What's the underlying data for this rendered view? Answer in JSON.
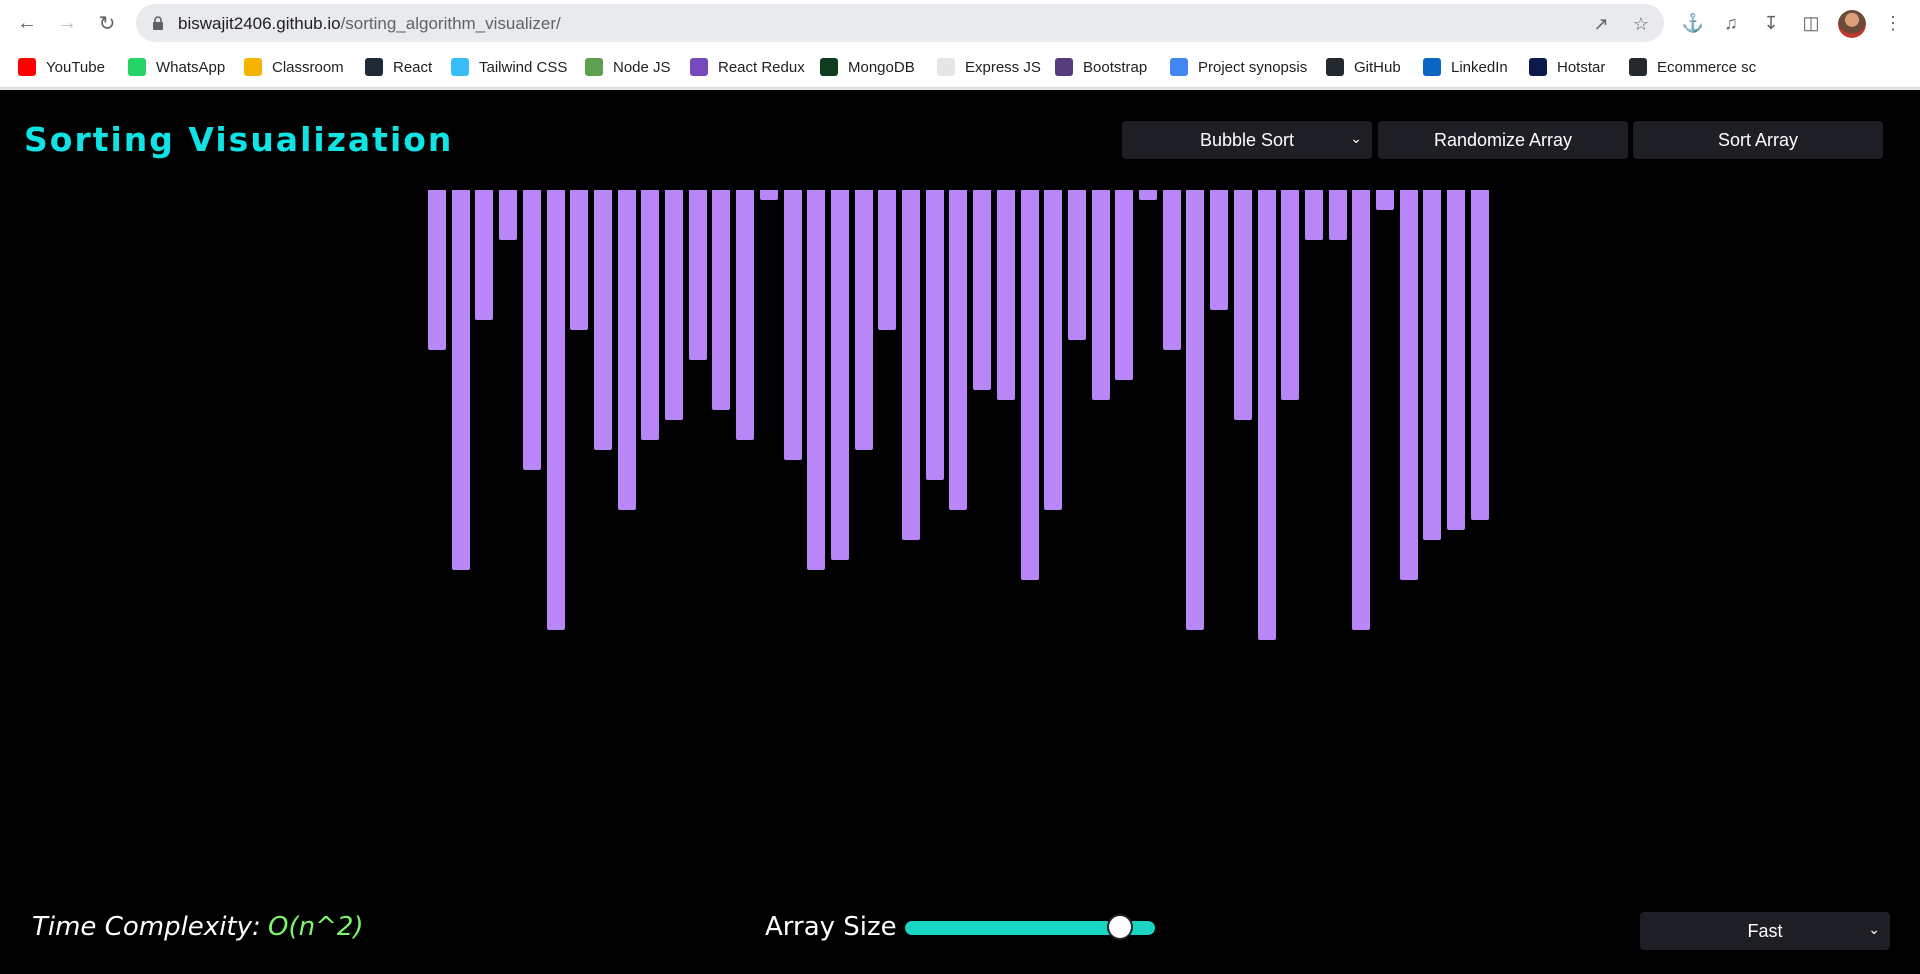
{
  "browser": {
    "url_host": "biswajit2406.github.io",
    "url_path": "/sorting_algorithm_visualizer/",
    "bookmarks": [
      {
        "label": "YouTube",
        "icon": "youtube-icon",
        "color": "#ff0000"
      },
      {
        "label": "WhatsApp",
        "icon": "whatsapp-icon",
        "color": "#25d366"
      },
      {
        "label": "Classroom",
        "icon": "classroom-icon",
        "color": "#f4b400"
      },
      {
        "label": "React",
        "icon": "react-icon",
        "color": "#1e2a38"
      },
      {
        "label": "Tailwind CSS",
        "icon": "tailwind-icon",
        "color": "#38bdf8"
      },
      {
        "label": "Node JS",
        "icon": "nodejs-icon",
        "color": "#5fa04e"
      },
      {
        "label": "React Redux",
        "icon": "redux-icon",
        "color": "#764abc"
      },
      {
        "label": "MongoDB",
        "icon": "mongodb-icon",
        "color": "#0f3d1e"
      },
      {
        "label": "Express JS",
        "icon": "express-icon",
        "color": "#e6e6e6"
      },
      {
        "label": "Bootstrap",
        "icon": "bootstrap-icon",
        "color": "#563d7c"
      },
      {
        "label": "Project synopsis",
        "icon": "docs-icon",
        "color": "#4285f4"
      },
      {
        "label": "GitHub",
        "icon": "github-icon",
        "color": "#24292e"
      },
      {
        "label": "LinkedIn",
        "icon": "linkedin-icon",
        "color": "#0a66c2"
      },
      {
        "label": "Hotstar",
        "icon": "hotstar-icon",
        "color": "#0c1a4a"
      },
      {
        "label": "Ecommerce sc",
        "icon": "github-icon",
        "color": "#24292e"
      }
    ]
  },
  "app": {
    "title": "Sorting Visualization",
    "algorithm_select": "Bubble Sort",
    "randomize_label": "Randomize Array",
    "sort_label": "Sort Array",
    "time_complexity_label": "Time Complexity:",
    "time_complexity_value": "O(n^2)",
    "array_size_label": "Array Size",
    "array_size_fraction": 0.86,
    "speed_select": "Fast",
    "accent_color": "#0fe3e3",
    "bar_color": "#b886f7",
    "complexity_color": "#7cf76b"
  },
  "array_values": [
    160,
    380,
    130,
    50,
    280,
    440,
    140,
    260,
    320,
    250,
    230,
    170,
    220,
    250,
    10,
    270,
    380,
    370,
    260,
    140,
    350,
    290,
    320,
    200,
    210,
    390,
    320,
    150,
    210,
    190,
    10,
    160,
    440,
    120,
    230,
    450,
    210,
    50,
    50,
    440,
    20,
    390,
    350,
    340,
    330
  ]
}
